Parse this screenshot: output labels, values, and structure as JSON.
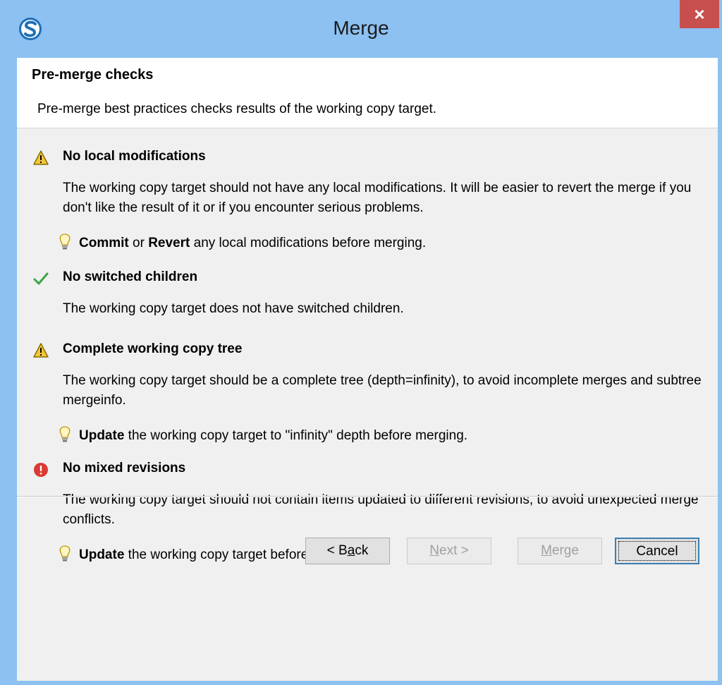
{
  "window": {
    "title": "Merge",
    "close_label": "×"
  },
  "header": {
    "title": "Pre-merge checks",
    "description": "Pre-merge best practices checks results of the working copy target."
  },
  "checks": [
    {
      "status": "warning",
      "title": "No local modifications",
      "description": "The working copy target should not have any local modifications. It will be easier to revert the merge if you don't like the result of it or if you encounter serious problems.",
      "hint": {
        "bold1": "Commit",
        "mid": " or ",
        "bold2": "Revert",
        "rest": " any local modifications before merging."
      }
    },
    {
      "status": "ok",
      "title": "No switched children",
      "description": "The working copy target does not have switched children."
    },
    {
      "status": "warning",
      "title": "Complete working copy tree",
      "description": "The working copy target should be a complete tree (depth=infinity), to avoid incomplete merges and subtree mergeinfo.",
      "hint": {
        "bold1": "Update",
        "rest": " the working copy target to \"infinity\" depth before merging."
      }
    },
    {
      "status": "error",
      "title": "No mixed revisions",
      "description": "The working copy target should not contain items updated to different revisions, to avoid unexpected merge conflicts.",
      "hint": {
        "bold1": "Update",
        "rest": " the working copy target before merging."
      }
    }
  ],
  "buttons": {
    "back": {
      "pre": "< B",
      "mnemonic": "a",
      "post": "ck"
    },
    "next": {
      "mnemonic": "N",
      "post": "ext >"
    },
    "merge": {
      "mnemonic": "M",
      "post": "erge"
    },
    "cancel": "Cancel"
  },
  "colors": {
    "titlebar": "#8cc1f2",
    "close": "#c7504e",
    "ok": "#3aa547",
    "warning": "#f3c63a",
    "error": "#d93a33"
  }
}
